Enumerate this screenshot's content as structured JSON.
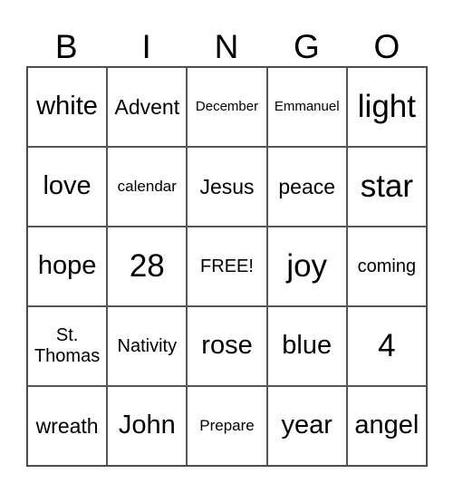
{
  "header": [
    "B",
    "I",
    "N",
    "G",
    "O"
  ],
  "cells": [
    [
      "white",
      "Advent",
      "December",
      "Emmanuel",
      "light"
    ],
    [
      "love",
      "calendar",
      "Jesus",
      "peace",
      "star"
    ],
    [
      "hope",
      "28",
      "FREE!",
      "joy",
      "coming"
    ],
    [
      "St. Thomas",
      "Nativity",
      "rose",
      "blue",
      "4"
    ],
    [
      "wreath",
      "John",
      "Prepare",
      "year",
      "angel"
    ]
  ]
}
